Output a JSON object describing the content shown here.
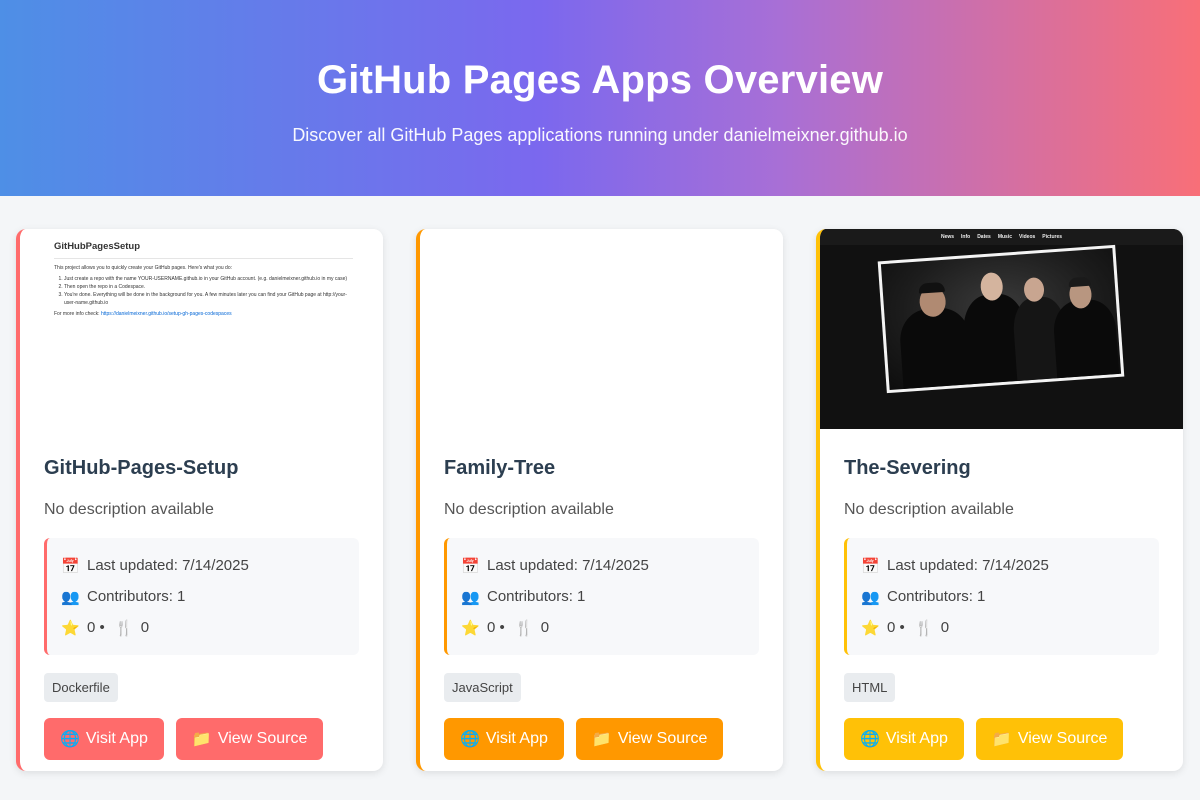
{
  "header": {
    "title": "GitHub Pages Apps Overview",
    "subtitle": "Discover all GitHub Pages applications running under danielmeixner.github.io"
  },
  "cards": [
    {
      "accent": "#ff6b6b",
      "name": "GitHub-Pages-Setup",
      "description": "No description available",
      "last_updated": "Last updated: 7/14/2025",
      "contributors": "Contributors: 1",
      "stars": "0 •",
      "forks": "0",
      "language": "Dockerfile",
      "visit_label": "Visit App",
      "source_label": "View Source",
      "preview": {
        "heading": "GitHubPagesSetup",
        "intro": "This project allows you to quickly create your GitHub pages. Here's what you do:",
        "steps": [
          "Just create a repo with the name YOUR-USERNAME.github.io in your GitHub account. (e.g. danielmeixner.github.io in my case)",
          "Then open the repo in a Codespace.",
          "You're done. Everything will be done in the background for you. A few minutes later you can find your GitHub page at http://your-user-name.github.io"
        ],
        "more_prefix": "For more info check:",
        "more_link": "https://danielmeixner.github.io/setup-gh-pages-codespaces"
      }
    },
    {
      "accent": "#ff9800",
      "name": "Family-Tree",
      "description": "No description available",
      "last_updated": "Last updated: 7/14/2025",
      "contributors": "Contributors: 1",
      "stars": "0 •",
      "forks": "0",
      "language": "JavaScript",
      "visit_label": "Visit App",
      "source_label": "View Source"
    },
    {
      "accent": "#ffc107",
      "name": "The-Severing",
      "description": "No description available",
      "last_updated": "Last updated: 7/14/2025",
      "contributors": "Contributors: 1",
      "stars": "0 •",
      "forks": "0",
      "language": "HTML",
      "visit_label": "Visit App",
      "source_label": "View Source",
      "preview": {
        "nav": [
          "News",
          "Info",
          "Dates",
          "Music",
          "Videos",
          "Pictures"
        ]
      }
    }
  ],
  "icons": {
    "calendar": "📅",
    "contributors": "👥",
    "star": "⭐",
    "fork": "🍴",
    "globe": "🌐",
    "folder": "📁"
  }
}
